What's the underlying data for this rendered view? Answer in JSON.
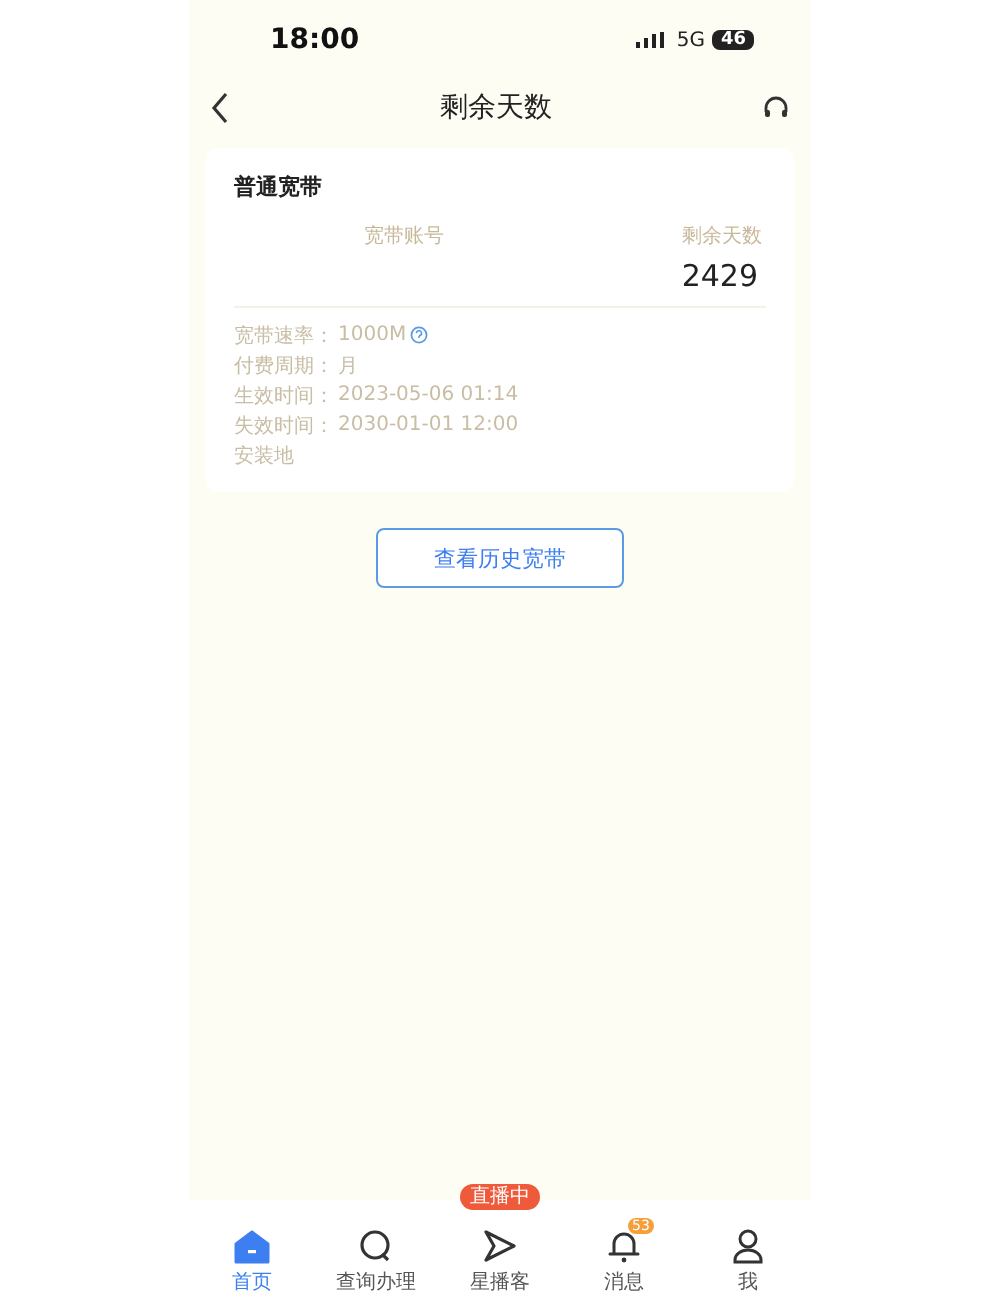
{
  "status_bar": {
    "time": "18:00",
    "network": "5G",
    "battery": "46"
  },
  "nav": {
    "title": "剩余天数"
  },
  "card": {
    "title": "普通宽带",
    "column_1": "宽带账号",
    "column_2": "剩余天数",
    "days": "2429",
    "fields": [
      {
        "label": "宽带速率：",
        "value": "1000M",
        "info": true
      },
      {
        "label": "付费周期：",
        "value": "月",
        "info": false
      },
      {
        "label": "生效时间：",
        "value": "2023-05-06 01:14",
        "info": false
      },
      {
        "label": "失效时间：",
        "value": "2030-01-01 12:00",
        "info": false
      },
      {
        "label": "安装地",
        "info": false
      }
    ]
  },
  "history_button": "查看历史宽带",
  "live_badge": "直播中",
  "tabs": [
    {
      "label": "首页",
      "kind": "home",
      "selected": true
    },
    {
      "label": "查询办理",
      "kind": "search",
      "selected": false
    },
    {
      "label": "星播客",
      "kind": "send",
      "selected": false
    },
    {
      "label": "消息",
      "kind": "bell",
      "selected": false,
      "badge": "53"
    },
    {
      "label": "我",
      "kind": "person",
      "selected": false
    }
  ]
}
